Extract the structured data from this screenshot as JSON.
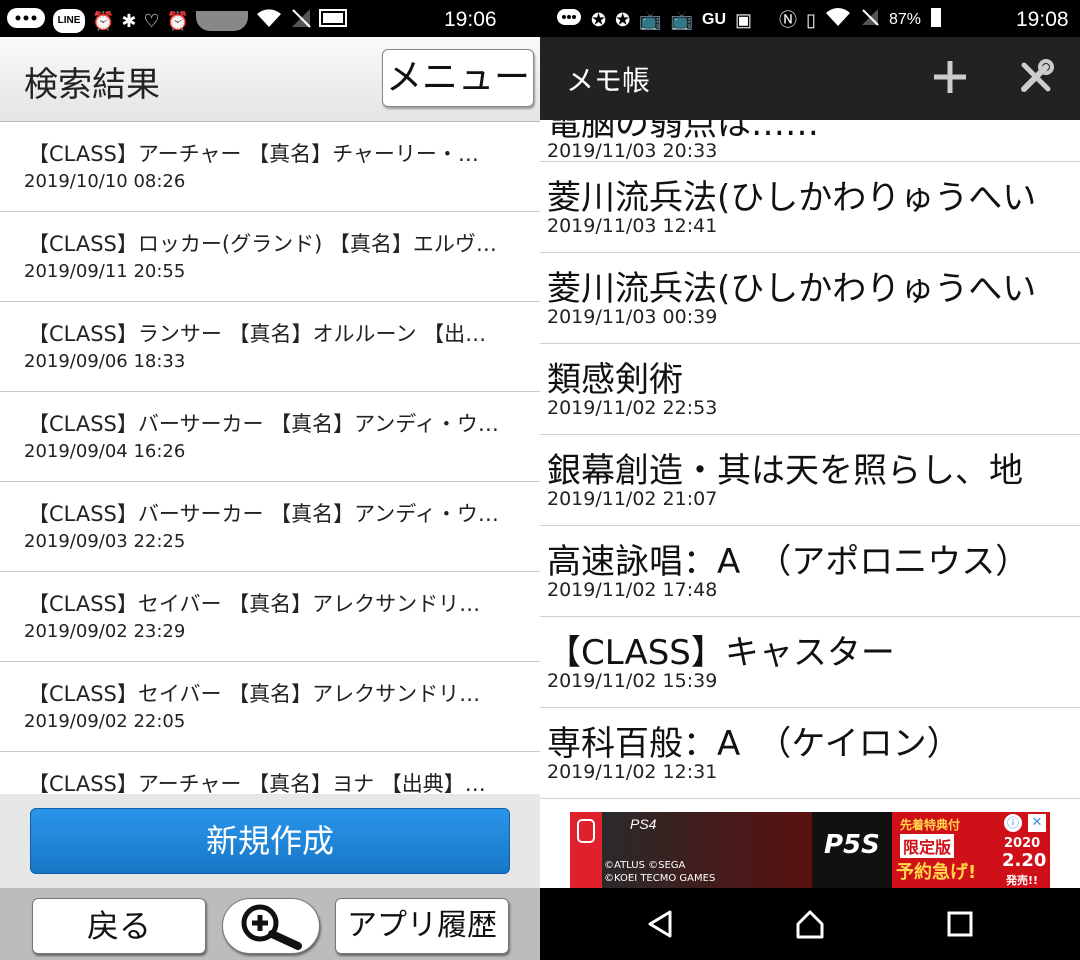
{
  "left": {
    "status": {
      "time": "19:06",
      "line_badge": "LINE"
    },
    "header": {
      "title": "検索結果",
      "menu_label": "メニュー"
    },
    "items": [
      {
        "title": "【CLASS】アーチャー 【真名】チャーリー・…",
        "date": "2019/10/10 08:26"
      },
      {
        "title": "【CLASS】ロッカー(グランド) 【真名】エルヴ…",
        "date": "2019/09/11 20:55"
      },
      {
        "title": "【CLASS】ランサー 【真名】オルルーン 【出…",
        "date": "2019/09/06 18:33"
      },
      {
        "title": "【CLASS】バーサーカー 【真名】アンディ・ウ…",
        "date": "2019/09/04 16:26"
      },
      {
        "title": "【CLASS】バーサーカー 【真名】アンディ・ウ…",
        "date": "2019/09/03 22:25"
      },
      {
        "title": "【CLASS】セイバー 【真名】アレクサンドリ…",
        "date": "2019/09/02 23:29"
      },
      {
        "title": "【CLASS】セイバー 【真名】アレクサンドリ…",
        "date": "2019/09/02 22:05"
      },
      {
        "title": "【CLASS】アーチャー 【真名】ヨナ 【出典】…",
        "date": ""
      }
    ],
    "new_button": "新規作成",
    "bottom": {
      "back": "戻る",
      "history": "アプリ履歴"
    }
  },
  "right": {
    "status": {
      "time": "19:08",
      "battery": "87%",
      "gu": "GU"
    },
    "header": {
      "title": "メモ帳"
    },
    "items": [
      {
        "title": "電脳の弱点は……",
        "date": "2019/11/03 20:33",
        "partial": true
      },
      {
        "title": "菱川流兵法(ひしかわりゅうへい",
        "date": "2019/11/03 12:41"
      },
      {
        "title": "菱川流兵法(ひしかわりゅうへい",
        "date": "2019/11/03 00:39"
      },
      {
        "title": "類感剣術",
        "date": "2019/11/02 22:53"
      },
      {
        "title": "銀幕創造・其は天を照らし、地",
        "date": "2019/11/02 21:07"
      },
      {
        "title": "高速詠唱：A　（アポロニウス）",
        "date": "2019/11/02 17:48"
      },
      {
        "title": "【CLASS】キャスター",
        "date": "2019/11/02 15:39"
      },
      {
        "title": "専科百般：A　（ケイロン）",
        "date": "2019/11/02 12:31"
      }
    ],
    "ad": {
      "platform": "PS4",
      "copyright1": "©ATLUS ©SEGA",
      "copyright2": "©KOEI TECMO GAMES",
      "game": "P5S",
      "tag1": "先着特典付",
      "tag2": "限定版",
      "tag3": "予約急げ!",
      "year": "2020",
      "date": "2.20",
      "release": "発売!!"
    }
  },
  "colors": {
    "primary_button": "#1a84d8",
    "dark_header": "#222222"
  }
}
